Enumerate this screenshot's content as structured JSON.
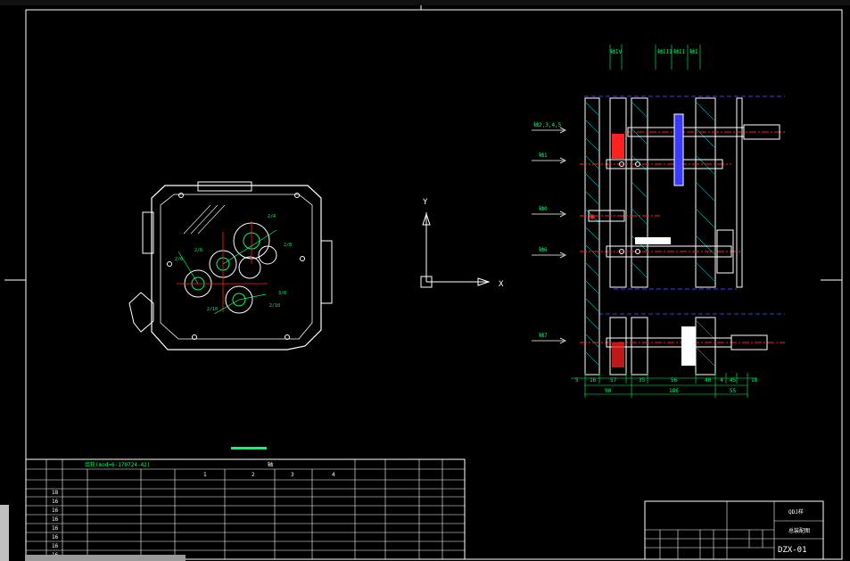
{
  "colors": {
    "background": "#000000",
    "frame": "#ffffff",
    "green": "#00ff66",
    "yellow": "#ffff00",
    "red": "#ff2020",
    "blue": "#3b3bff",
    "cyan": "#00ffff",
    "magenta": "#ff00ff"
  },
  "ucs": {
    "y_label": "Y",
    "x_label": "X"
  },
  "housing": {
    "callouts": [
      "2/4",
      "2/6",
      "2/6",
      "2/8",
      "3/8",
      "2/10",
      "2/10"
    ]
  },
  "section_view": {
    "header_labels": [
      "轴IV",
      "轴III",
      "轴II",
      "轴I"
    ],
    "arrow_labels": [
      "轴2,3,4,5",
      "轴1",
      "轴0",
      "轴6",
      "轴7"
    ],
    "dims_top": [
      "5",
      "16",
      "57",
      "35",
      "56",
      "40",
      "4",
      "45",
      "18"
    ],
    "dims_bottom": [
      "90",
      "186",
      "55"
    ]
  },
  "parts_table": {
    "title": "齿轮(mod=6-179724-42)",
    "group_header": "轴",
    "shaft_cols": [
      "1",
      "2",
      "3",
      "4"
    ],
    "rows": 8,
    "row_numbers": [
      "18",
      "16",
      "16",
      "16",
      "16",
      "16",
      "16",
      "16"
    ]
  },
  "title_block": {
    "unit_name": "QDJ样",
    "drawing_name": "总装配图",
    "drawing_no": "DZX-01"
  }
}
